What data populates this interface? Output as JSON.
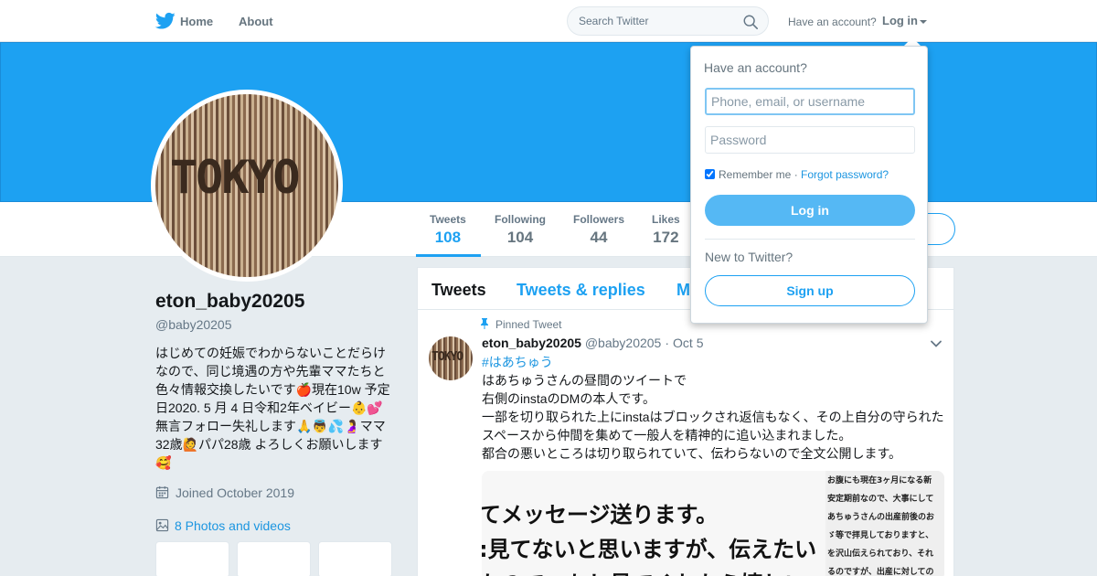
{
  "topbar": {
    "home_label": "Home",
    "about_label": "About",
    "search_placeholder": "Search Twitter",
    "have_account": "Have an account?",
    "login_label": "Log in",
    "brand_color": "#1da1f2"
  },
  "profile": {
    "name": "eton_baby20205",
    "handle": "@baby20205",
    "bio": "はじめての妊娠でわからないことだらけなので、同じ境遇の方や先輩ママたちと色々情報交換したいです🍎現在10w 予定日2020. 5 月 4 日令和2年ベイビー👶💕無言フォロー失礼します🙏👼💦🤰ママ32歳🙋パパ28歳 よろしくお願いします🥰",
    "joined": "Joined October 2019",
    "photos_link": "8 Photos and videos",
    "avatar_text": "TOKYO"
  },
  "stats": [
    {
      "label": "Tweets",
      "value": "108"
    },
    {
      "label": "Following",
      "value": "104"
    },
    {
      "label": "Followers",
      "value": "44"
    },
    {
      "label": "Likes",
      "value": "172"
    }
  ],
  "timeline": {
    "tabs": [
      "Tweets",
      "Tweets & replies",
      "M"
    ],
    "pinned_label": "Pinned Tweet",
    "tweet": {
      "name": "eton_baby20205",
      "handle": "@baby20205",
      "dot": "·",
      "time": "Oct 5",
      "hashtag": "#はあちゅう",
      "lines": [
        "はあちゅうさんの昼間のツイートで",
        "右側のinstaのDMの本人です。",
        "一部を切り取られた上にinstaはブロックされ返信もなく、その上自分の守られた",
        "スペースから仲間を集めて一般人を精神的に追い込まれました。",
        "都合の悪いところは切り取られていて、伝わらないので全文公開します。"
      ],
      "media_main": [
        "てメッセージ送ります。",
        ":見てないと思いますが、伝えたい",
        "たので、もし見てくれたら嬉しい"
      ],
      "media_side": [
        "お腹にも現在3ヶ月になる新",
        "安定期前なので、大事にして",
        "あちゅうさんの出産前後のお",
        "ゞ等で拝見しておりますと、",
        "を沢山伝えられており、それ",
        "るのですが、出産に対しての"
      ]
    }
  },
  "login_dropdown": {
    "title": "Have an account?",
    "username_placeholder": "Phone, email, or username",
    "password_placeholder": "Password",
    "remember_label": "Remember me",
    "separator": "·",
    "forgot_label": "Forgot password?",
    "login_button": "Log in",
    "new_to": "New to Twitter?",
    "signup_button": "Sign up"
  }
}
